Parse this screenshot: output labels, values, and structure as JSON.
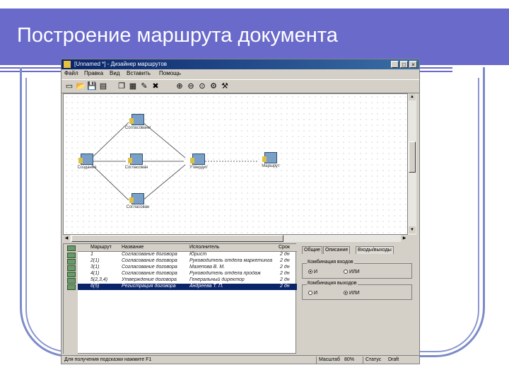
{
  "slide": {
    "title": "Построение маршрута документа"
  },
  "window": {
    "title": "[Unnamed *] - Дизайнер маршрутов",
    "controls": [
      "_",
      "□",
      "×"
    ]
  },
  "menu": [
    "Файл",
    "Правка",
    "Вид",
    "Вставить",
    "Помощь"
  ],
  "toolbar_icons": [
    "new-icon",
    "open-icon",
    "save-icon",
    "print-icon",
    "copy-icon",
    "paste-icon",
    "wizard-icon",
    "delete-icon",
    "zoom-in-icon",
    "zoom-out-icon",
    "zoom-fit-icon",
    "properties-icon"
  ],
  "diagram": {
    "nodes": [
      {
        "id": "start",
        "label": "Создание"
      },
      {
        "id": "approve-top",
        "label": "Согласовани"
      },
      {
        "id": "approve-mid",
        "label": "Согласован"
      },
      {
        "id": "approve-bottom",
        "label": "Согласован"
      },
      {
        "id": "sign",
        "label": "Утвердит"
      },
      {
        "id": "end",
        "label": "Маршрут"
      }
    ]
  },
  "table": {
    "headers": [
      "Маршрут",
      "Название",
      "Исполнитель",
      "Срок"
    ],
    "rows": [
      {
        "route": "1",
        "name": "Согласование договора",
        "executor": "Юрист",
        "term": "2 дн"
      },
      {
        "route": "2(1)",
        "name": "Согласование договора",
        "executor": "Руководитель отдела маркетинга",
        "term": "2 дн"
      },
      {
        "route": "3(1)",
        "name": "Согласование договора",
        "executor": "Мазепова В. М.",
        "term": "2 дн"
      },
      {
        "route": "4(1)",
        "name": "Согласование договора",
        "executor": "Руководитель отдела продаж",
        "term": "2 дн"
      },
      {
        "route": "5(2,3,4)",
        "name": "Утверждение договора",
        "executor": "Генеральный директор",
        "term": "2 дн"
      },
      {
        "route": "6(5)",
        "name": "Регистрация договора",
        "executor": "Андреева Т. П.",
        "term": "2 дн",
        "selected": true
      }
    ]
  },
  "props": {
    "tabs": [
      "Общие",
      "Описание",
      "Входы/выходы"
    ],
    "active_tab": "Входы/выходы",
    "group_in": {
      "title": "Комбинация входов",
      "opt1": "И",
      "opt2": "ИЛИ",
      "selected": "И"
    },
    "group_out": {
      "title": "Комбинация выходов",
      "opt1": "И",
      "opt2": "ИЛИ",
      "selected": "ИЛИ"
    }
  },
  "status": {
    "hint": "Для получения подсказки нажмите F1",
    "scale_label": "Масштаб",
    "scale_value": "80%",
    "state_label": "Статус",
    "state_value": "Draft"
  }
}
